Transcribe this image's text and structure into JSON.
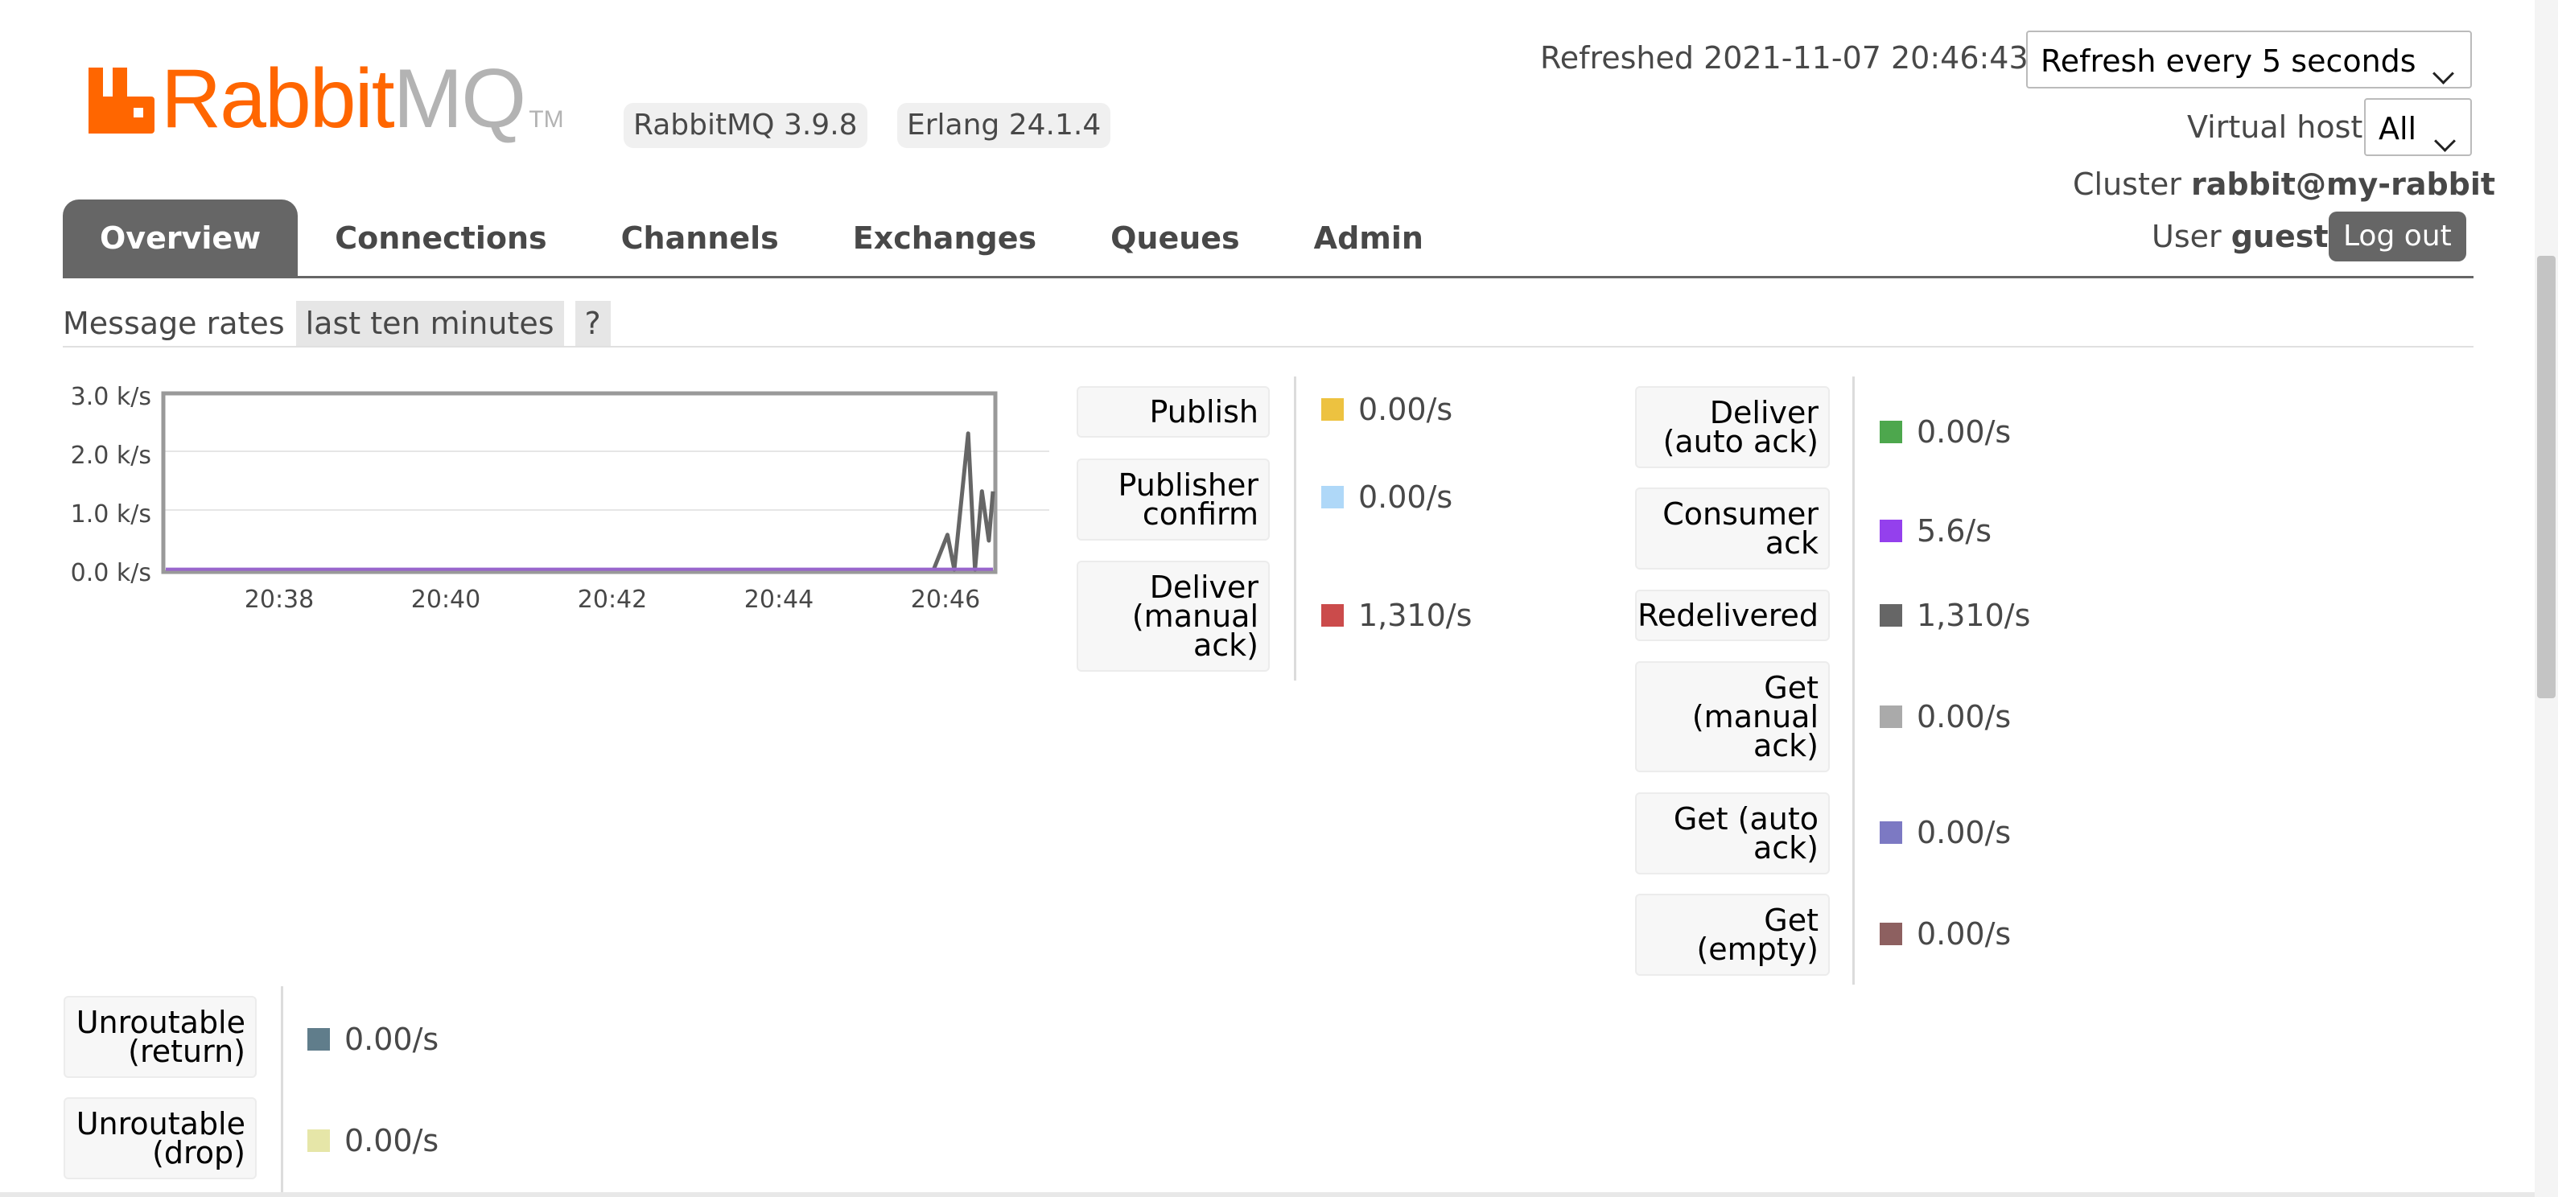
{
  "header": {
    "logo_rabbit": "Rabbit",
    "logo_mq": "MQ",
    "logo_tm": "TM",
    "version_rabbitmq": "RabbitMQ 3.9.8",
    "version_erlang": "Erlang 24.1.4",
    "refreshed_text": "Refreshed 2021-11-07 20:46:43",
    "refresh_select": "Refresh every 5 seconds",
    "vhost_label": "Virtual host",
    "vhost_select": "All",
    "cluster_label": "Cluster",
    "cluster_name": "rabbit@my-rabbit",
    "user_label": "User",
    "user_name": "guest",
    "logout_label": "Log out"
  },
  "tabs": [
    {
      "label": "Overview",
      "active": true
    },
    {
      "label": "Connections",
      "active": false
    },
    {
      "label": "Channels",
      "active": false
    },
    {
      "label": "Exchanges",
      "active": false
    },
    {
      "label": "Queues",
      "active": false
    },
    {
      "label": "Admin",
      "active": false
    }
  ],
  "section": {
    "title": "Message rates",
    "range": "last ten minutes",
    "help": "?"
  },
  "chart_data": {
    "type": "line",
    "y_ticks": [
      "3.0 k/s",
      "2.0 k/s",
      "1.0 k/s",
      "0.0 k/s"
    ],
    "x_ticks": [
      "20:38",
      "20:40",
      "20:42",
      "20:44",
      "20:46"
    ],
    "ylim": [
      0,
      3.0
    ],
    "y_unit": "k/s",
    "series": [
      {
        "color": "#666666",
        "x": [
          "20:46:00",
          "20:46:10",
          "20:46:15",
          "20:46:25",
          "20:46:30",
          "20:46:35",
          "20:46:40",
          "20:46:43"
        ],
        "values": [
          0,
          0.6,
          0,
          2.35,
          0,
          1.35,
          0.5,
          1.35
        ]
      },
      {
        "color": "#9966cc",
        "x": [
          "20:36:43",
          "20:46:43"
        ],
        "values": [
          0.006,
          0.006
        ]
      }
    ]
  },
  "legend_col1": [
    {
      "label": "Publish",
      "value": "0.00/s",
      "color": "#edc240"
    },
    {
      "label": "Publisher confirm",
      "value": "0.00/s",
      "color": "#afd8f8"
    },
    {
      "label": "Deliver (manual ack)",
      "value": "1,310/s",
      "color": "#cb4b4b"
    }
  ],
  "legend_col2": [
    {
      "label": "Deliver (auto ack)",
      "value": "0.00/s",
      "color": "#4da74d"
    },
    {
      "label": "Consumer ack",
      "value": "5.6/s",
      "color": "#9440ed"
    },
    {
      "label": "Redelivered",
      "value": "1,310/s",
      "color": "#666666"
    },
    {
      "label": "Get (manual ack)",
      "value": "0.00/s",
      "color": "#aaaaaa"
    },
    {
      "label": "Get (auto ack)",
      "value": "0.00/s",
      "color": "#7c79c3"
    },
    {
      "label": "Get (empty)",
      "value": "0.00/s",
      "color": "#8d6060"
    }
  ],
  "legend_col3": [
    {
      "label": "Unroutable (return)",
      "value": "0.00/s",
      "color": "#607d8b"
    },
    {
      "label": "Unroutable (drop)",
      "value": "0.00/s",
      "color": "#e6e6a8"
    }
  ]
}
